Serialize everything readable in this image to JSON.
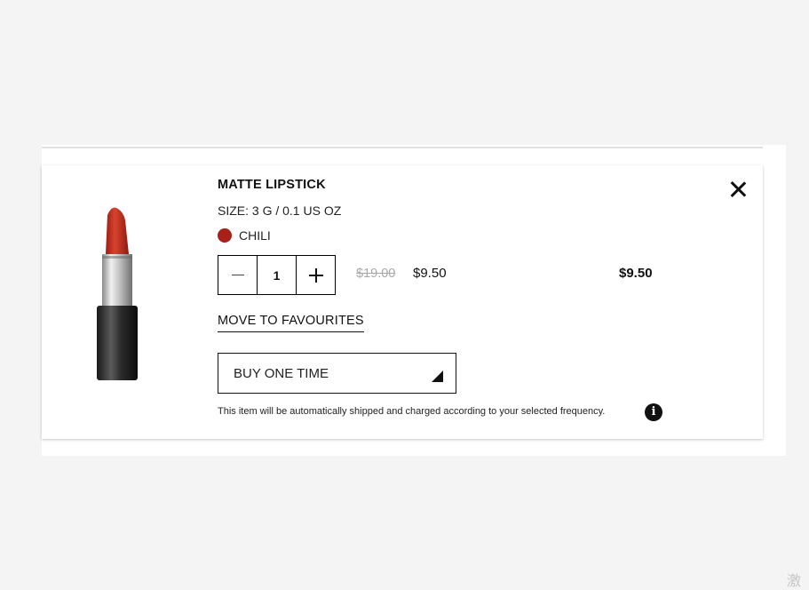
{
  "cart_item": {
    "name": "MATTE LIPSTICK",
    "size": "SIZE: 3 G / 0.1 US OZ",
    "shade": {
      "name": "CHILI",
      "color": "#a8201a"
    },
    "quantity": "1",
    "original_price": "$19.00",
    "sale_price": "$9.50",
    "line_total": "$9.50",
    "move_to_favourites_label": "MOVE TO FAVOURITES",
    "purchase_frequency": "BUY ONE TIME",
    "subscription_note": "This item will be automatically shipped and charged according to your selected frequency.",
    "info_glyph": "i"
  },
  "icons": {
    "close": "close-icon",
    "minus": "minus-icon",
    "plus": "plus-icon",
    "dropdown": "caret-down-icon",
    "info": "info-icon"
  },
  "watermark": "激"
}
